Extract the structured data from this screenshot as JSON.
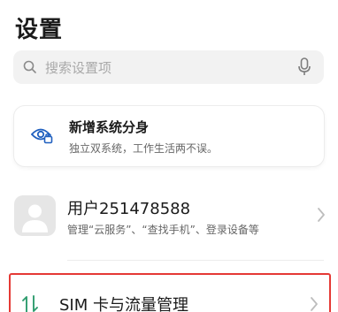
{
  "header": {
    "title": "设置"
  },
  "search": {
    "placeholder": "搜索设置项"
  },
  "feature_card": {
    "title": "新增系统分身",
    "subtitle": "独立双系统，工作生活两不误。"
  },
  "account": {
    "name": "用户251478588",
    "description": "管理“云服务”、“查找手机”、登录设备等"
  },
  "list": {
    "sim_label": "SIM 卡与流量管理"
  },
  "colors": {
    "highlight": "#e53935",
    "accent": "#2e9c6e",
    "icon_blue": "#1f5fbf"
  },
  "icons": [
    "search-icon",
    "microphone-icon",
    "dual-system-icon",
    "avatar-placeholder-icon",
    "chevron-right-icon",
    "data-transfer-icon"
  ]
}
